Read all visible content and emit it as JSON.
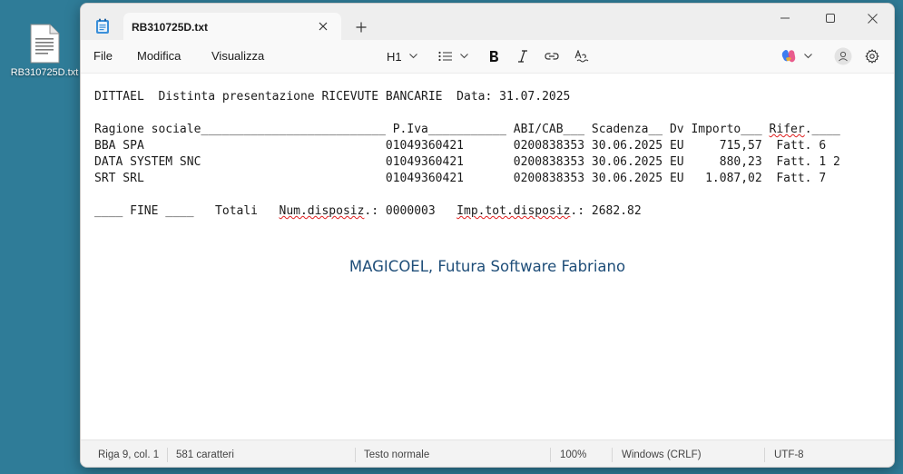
{
  "desktop": {
    "icon_label": "RB310725D.txt"
  },
  "window": {
    "tab_title": "RB310725D.txt",
    "new_tab": "+"
  },
  "menu": {
    "file": "File",
    "edit": "Modifica",
    "view": "Visualizza"
  },
  "toolbar": {
    "heading": "H1"
  },
  "document": {
    "header_line": "DITTAEL  Distinta presentazione RICEVUTE BANCARIE  Data: 31.07.2025",
    "col_header_a": "Ragione sociale__________________________ P.Iva___________ ABI/CAB___ Scadenza__ Dv Importo___ ",
    "col_header_b": "Rifer",
    "col_header_c": ".____",
    "rows": [
      "BBA SPA                                  01049360421       0200838353 30.06.2025 EU     715,57  Fatt. 6",
      "DATA SYSTEM SNC                          01049360421       0200838353 30.06.2025 EU     880,23  Fatt. 1 2",
      "SRT SRL                                  01049360421       0200838353 30.06.2025 EU   1.087,02  Fatt. 7"
    ],
    "totals_a": "____ FINE ____   Totali   ",
    "totals_b": "Num.disposiz",
    "totals_c": ".: 0000003   ",
    "totals_d": "Imp.tot.disposiz",
    "totals_e": ".: 2682.82",
    "footer_note": "MAGICOEL, Futura Software Fabriano"
  },
  "status": {
    "position": "Riga 9, col. 1",
    "chars": "581 caratteri",
    "format": "Testo normale",
    "zoom": "100%",
    "line_ending": "Windows (CRLF)",
    "encoding": "UTF-8"
  },
  "colors": {
    "desktop": "#2f7c98",
    "footer_note": "#1f4e79",
    "spellcheck": "#e02020"
  }
}
